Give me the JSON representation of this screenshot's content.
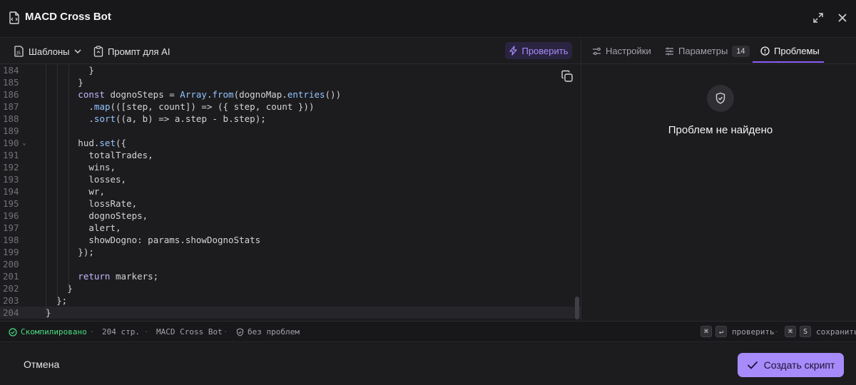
{
  "window": {
    "title": "MACD Cross Bot"
  },
  "toolbar": {
    "templates_label": "Шаблоны",
    "prompt_label": "Промпт для AI",
    "check_label": "Проверить"
  },
  "right_tabs": [
    {
      "label": "Настройки"
    },
    {
      "label": "Параметры",
      "badge": "14"
    },
    {
      "label": "Проблемы"
    }
  ],
  "problems": {
    "empty_text": "Проблем не найдено"
  },
  "editor": {
    "lines": [
      {
        "n": "184",
        "indent": 8,
        "tokens": [
          [
            "p",
            "}"
          ]
        ]
      },
      {
        "n": "185",
        "indent": 6,
        "tokens": [
          [
            "p",
            "}"
          ]
        ]
      },
      {
        "n": "186",
        "indent": 6,
        "tokens": [
          [
            "kw",
            "const"
          ],
          [
            "p",
            " dognoSteps = "
          ],
          [
            "fn",
            "Array"
          ],
          [
            "p",
            "."
          ],
          [
            "fn",
            "from"
          ],
          [
            "p",
            "(dognoMap."
          ],
          [
            "fn",
            "entries"
          ],
          [
            "p",
            "())"
          ]
        ]
      },
      {
        "n": "187",
        "indent": 8,
        "tokens": [
          [
            "p",
            "."
          ],
          [
            "fn",
            "map"
          ],
          [
            "p",
            "(([step, count]) => ({ step, count }))"
          ]
        ]
      },
      {
        "n": "188",
        "indent": 8,
        "tokens": [
          [
            "p",
            "."
          ],
          [
            "fn",
            "sort"
          ],
          [
            "p",
            "((a, b) => a.step - b.step);"
          ]
        ]
      },
      {
        "n": "189",
        "indent": 0,
        "tokens": []
      },
      {
        "n": "190",
        "indent": 6,
        "fold": true,
        "tokens": [
          [
            "p",
            "hud."
          ],
          [
            "fn",
            "set"
          ],
          [
            "p",
            "({"
          ]
        ]
      },
      {
        "n": "191",
        "indent": 8,
        "tokens": [
          [
            "p",
            "totalTrades,"
          ]
        ]
      },
      {
        "n": "192",
        "indent": 8,
        "tokens": [
          [
            "p",
            "wins,"
          ]
        ]
      },
      {
        "n": "193",
        "indent": 8,
        "tokens": [
          [
            "p",
            "losses,"
          ]
        ]
      },
      {
        "n": "194",
        "indent": 8,
        "tokens": [
          [
            "p",
            "wr,"
          ]
        ]
      },
      {
        "n": "195",
        "indent": 8,
        "tokens": [
          [
            "p",
            "lossRate,"
          ]
        ]
      },
      {
        "n": "196",
        "indent": 8,
        "tokens": [
          [
            "p",
            "dognoSteps,"
          ]
        ]
      },
      {
        "n": "197",
        "indent": 8,
        "tokens": [
          [
            "p",
            "alert,"
          ]
        ]
      },
      {
        "n": "198",
        "indent": 8,
        "tokens": [
          [
            "p",
            "showDogno: params.showDognoStats"
          ]
        ]
      },
      {
        "n": "199",
        "indent": 6,
        "tokens": [
          [
            "p",
            "});"
          ]
        ]
      },
      {
        "n": "200",
        "indent": 0,
        "tokens": []
      },
      {
        "n": "201",
        "indent": 6,
        "tokens": [
          [
            "kw",
            "return"
          ],
          [
            "p",
            " markers;"
          ]
        ]
      },
      {
        "n": "202",
        "indent": 4,
        "tokens": [
          [
            "p",
            "}"
          ]
        ]
      },
      {
        "n": "203",
        "indent": 2,
        "tokens": [
          [
            "p",
            "};"
          ]
        ]
      },
      {
        "n": "204",
        "indent": 0,
        "active": true,
        "tokens": [
          [
            "p",
            "}"
          ]
        ]
      }
    ]
  },
  "status": {
    "compiled": "Скомпилировано",
    "lines": "204 стр.",
    "name": "MACD Cross Bot",
    "problems": "без проблем",
    "check_hint": "проверить",
    "save_hint": "сохранить",
    "key_cmd": "⌘",
    "key_enter": "↵",
    "key_s": "S"
  },
  "footer": {
    "cancel_label": "Отмена",
    "create_label": "Создать скрипт"
  },
  "colors": {
    "accent": "#a78bfa",
    "ok": "#4ade80"
  }
}
